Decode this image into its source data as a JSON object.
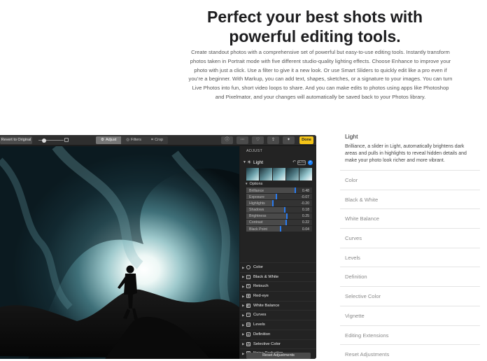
{
  "headline": {
    "line1": "Perfect your best shots with",
    "line2": "powerful editing tools."
  },
  "body_copy": "Create standout photos with a comprehensive set of powerful but easy-to-use editing tools. Instantly transform photos taken in Portrait mode with five different studio-quality lighting effects. Choose Enhance to improve your photo with just a click. Use a filter to give it a new look. Or use Smart Sliders to quickly edit like a pro even if you’re a beginner. With Markup, you can add text, shapes, sketches, or a signature to your images. You can turn Live Photos into fun, short video loops to share. And you can make edits to photos using apps like Photoshop and Pixelmator, and your changes will automatically be saved back to your Photos library.",
  "toolbar": {
    "revert_label": "Revert to Original",
    "tabs": [
      {
        "label": "Adjust",
        "icon": "adjust-icon",
        "active": true
      },
      {
        "label": "Filters",
        "icon": "filters-icon",
        "active": false
      },
      {
        "label": "Crop",
        "icon": "crop-icon",
        "active": false
      }
    ],
    "done_label": "Done"
  },
  "panel": {
    "title": "ADJUST",
    "light_label": "Light",
    "auto_label": "AUTO",
    "options_label": "Options",
    "sliders": [
      {
        "name": "Brilliance",
        "value": "0.48",
        "pos": 0.74
      },
      {
        "name": "Exposure",
        "value": "-0.07",
        "pos": 0.46
      },
      {
        "name": "Highlights",
        "value": "-0.20",
        "pos": 0.4
      },
      {
        "name": "Shadows",
        "value": "0.18",
        "pos": 0.59
      },
      {
        "name": "Brightness",
        "value": "0.25",
        "pos": 0.62
      },
      {
        "name": "Contrast",
        "value": "0.22",
        "pos": 0.61
      },
      {
        "name": "Black Point",
        "value": "0.04",
        "pos": 0.52
      }
    ],
    "sections": [
      {
        "label": "Color",
        "icon": "color-icon"
      },
      {
        "label": "Black & White",
        "icon": "black-white-icon"
      },
      {
        "label": "Retouch",
        "icon": "retouch-icon"
      },
      {
        "label": "Red-eye",
        "icon": "red-eye-icon"
      },
      {
        "label": "White Balance",
        "icon": "white-balance-icon"
      },
      {
        "label": "Curves",
        "icon": "curves-icon"
      },
      {
        "label": "Levels",
        "icon": "levels-icon"
      },
      {
        "label": "Definition",
        "icon": "definition-icon"
      },
      {
        "label": "Selective Color",
        "icon": "selective-color-icon"
      },
      {
        "label": "Noise Reduction",
        "icon": "noise-reduction-icon"
      }
    ],
    "reset_label": "Reset Adjustments"
  },
  "features": {
    "active": {
      "title": "Light",
      "description": "Brilliance, a slider in Light, automatically brightens dark areas and pulls in highlights to reveal hidden details and make your photo look richer and more vibrant."
    },
    "items": [
      "Color",
      "Black & White",
      "White Balance",
      "Curves",
      "Levels",
      "Definition",
      "Selective Color",
      "Vignette",
      "Editing Extensions",
      "Reset Adjustments"
    ]
  },
  "colors": {
    "accent_blue": "#2a7cf0",
    "done_yellow": "#f5c518",
    "panel_bg": "#232323"
  }
}
